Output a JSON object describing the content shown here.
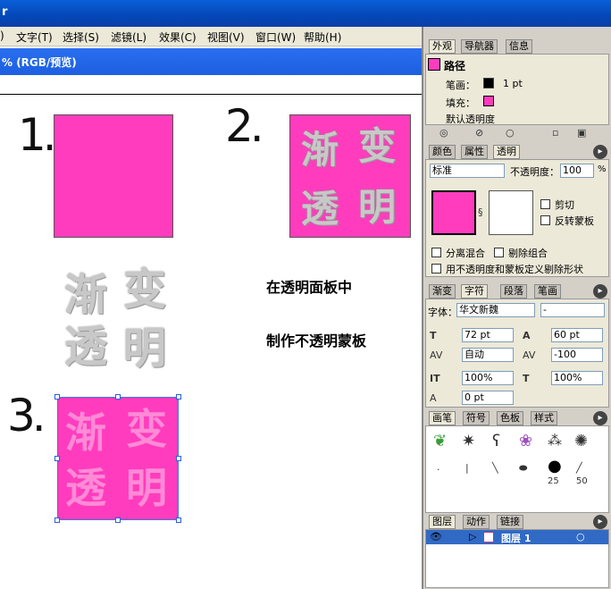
{
  "titlebar": {
    "text": "r"
  },
  "menu": [
    "文字(T)",
    "选择(S)",
    "滤镜(L)",
    "效果(C)",
    "视图(V)",
    "窗口(W)",
    "帮助(H)"
  ],
  "menu_prefix": ")",
  "doc": {
    "title": "% (RGB/预览)"
  },
  "canvas": {
    "n1": "1.",
    "n2": "2.",
    "n3": "3.",
    "chars": [
      "渐",
      "变",
      "透",
      "明"
    ],
    "note1": "在透明面板中",
    "note2": "制作不透明蒙板"
  },
  "panel1": {
    "tabs": [
      "外观",
      "导航器",
      "信息"
    ],
    "path": "路径",
    "stroke_label": "笔画：",
    "stroke_val": "1 pt",
    "fill_label": "填充：",
    "opacity_label": "默认透明度"
  },
  "panel2": {
    "tabs": [
      "颜色",
      "属性",
      "透明"
    ],
    "mode": "标准",
    "opacity_label": "不透明度：",
    "opacity_val": "100",
    "percent": "%",
    "clip": "剪切",
    "invert": "反转蒙板",
    "isolate": "分离混合",
    "knockout": "剔除组合",
    "shape": "用不透明度和蒙板定义剔除形状"
  },
  "panel3": {
    "tabs": [
      "渐变",
      "字符",
      "段落",
      "笔画"
    ],
    "font_label": "字体：",
    "font": "华文新魏",
    "style": "-",
    "size": "72 pt",
    "leading": "60 pt",
    "kern": "自动",
    "track": "-100",
    "vscale": "100%",
    "hscale": "100%",
    "baseline": "0 pt"
  },
  "panel4": {
    "tabs": [
      "画笔",
      "符号",
      "色板",
      "样式"
    ],
    "sizes": [
      "25",
      "50"
    ]
  },
  "panel5": {
    "tabs": [
      "图层",
      "动作",
      "链接"
    ],
    "layer": "图层 1"
  },
  "colors": {
    "pink": "#ff3cbe",
    "title": "#0a5fd8",
    "layer_sel": "#316ac5"
  }
}
